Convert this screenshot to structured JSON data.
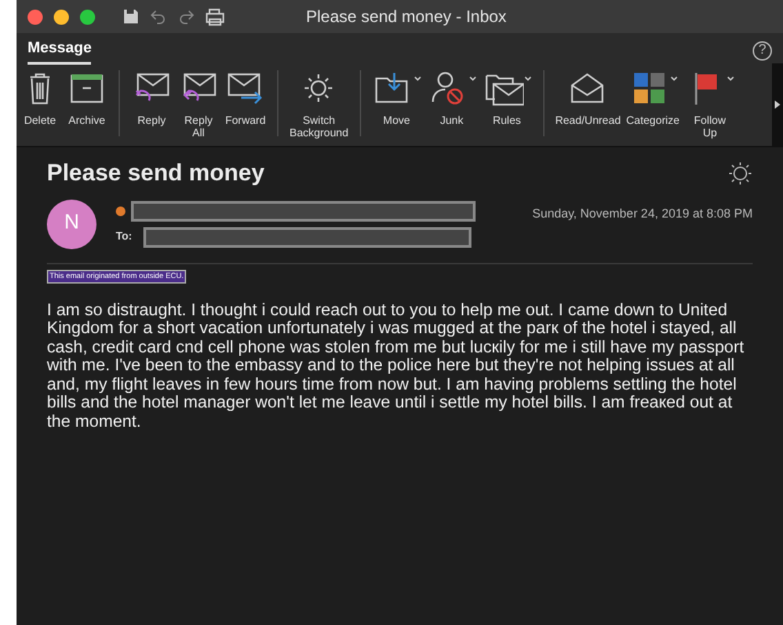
{
  "window": {
    "title": "Please send money - Inbox"
  },
  "tabs": [
    {
      "label": "Message",
      "selected": true
    }
  ],
  "help": {
    "label": "?"
  },
  "ribbon": [
    {
      "label": "Delete",
      "dropdown": false
    },
    {
      "label": "Archive",
      "dropdown": false
    },
    {
      "label": "Reply",
      "dropdown": false
    },
    {
      "label": "Reply All",
      "dropdown": false
    },
    {
      "label": "Forward",
      "dropdown": false
    },
    {
      "label": "Switch Background",
      "dropdown": false
    },
    {
      "label": "Move",
      "dropdown": true
    },
    {
      "label": "Junk",
      "dropdown": true
    },
    {
      "label": "Rules",
      "dropdown": true
    },
    {
      "label": "Read/Unread",
      "dropdown": false
    },
    {
      "label": "Categorize",
      "dropdown": true
    },
    {
      "label": "Follow Up",
      "dropdown": true
    }
  ],
  "message": {
    "subject": "Please send money",
    "avatar": "N",
    "to_label": "To:",
    "date": "Sunday, November 24, 2019 at 8:08 PM",
    "banner": "This email originated from outside ECU.",
    "body": "I am so distraught. I thought i could reach out to you to help me out. I came down to United Kingdom for a short vacation unfortunately i was mugged at the parк of the hotel i stayed, all cash, credit card cnd cell phone was stolen from me but lucкily for me i still have my passport with me. I've been to the embassy and to the police here but they're not helping issues at all and, my flight leaves in few hours time from now but. I am having problems settling the hotel bills and the hotel manager won't let me leave until i settle my hotel bills. I am freaкed out at the moment."
  }
}
